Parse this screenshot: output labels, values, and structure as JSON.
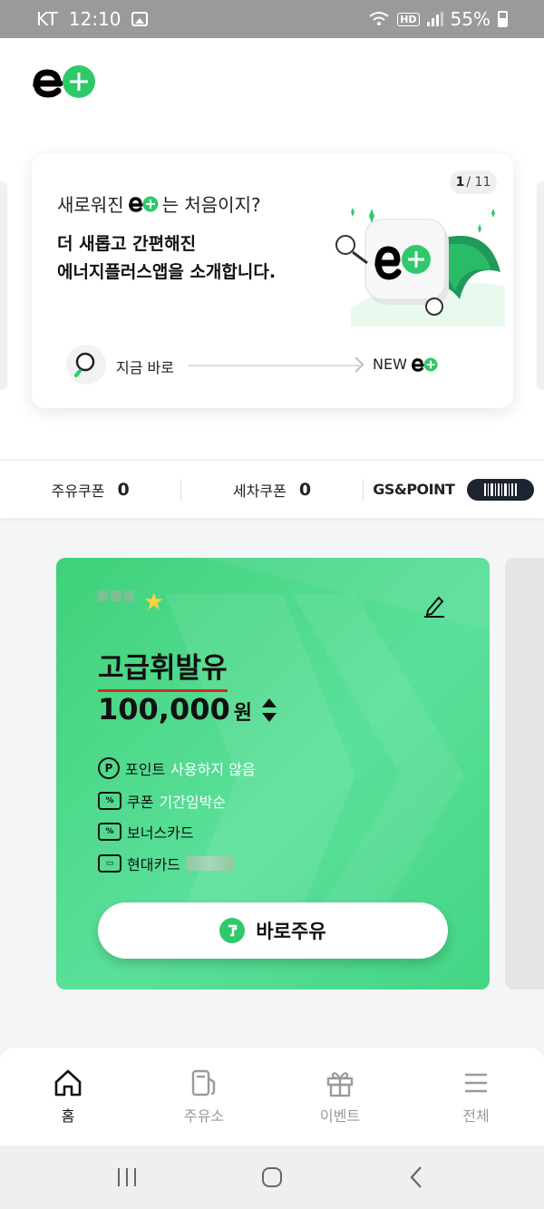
{
  "status_bar": {
    "carrier": "KT",
    "time": "12:10",
    "battery": "55%",
    "network_badge": "HD"
  },
  "banner": {
    "title_before": "새로워진",
    "title_after": "는 처음이지?",
    "subtitle_line1": "더 새롭고 간편해진",
    "subtitle_line2": "에너지플러스앱을 소개합니다.",
    "pager_current": "1",
    "pager_total": "/ 11",
    "now_label": "지금 바로",
    "new_label": "NEW"
  },
  "coupons": {
    "fuel_label": "주유쿠폰",
    "fuel_count": "0",
    "wash_label": "세차쿠폰",
    "wash_count": "0",
    "gs_label": "GS&POINT"
  },
  "fuel_card": {
    "fuel_type": "고급휘발유",
    "amount": "100,000",
    "currency": "원",
    "point_label": "포인트",
    "point_value": "사용하지 않음",
    "coupon_label": "쿠폰",
    "coupon_value": "기간임박순",
    "bonus_card_label": "보너스카드",
    "card_label": "현대카드",
    "action_label": "바로주유"
  },
  "tabs": [
    {
      "label": "홈",
      "icon": "home-icon",
      "active": true
    },
    {
      "label": "주유소",
      "icon": "gas-pump-icon",
      "active": false
    },
    {
      "label": "이벤트",
      "icon": "gift-icon",
      "active": false
    },
    {
      "label": "전체",
      "icon": "menu-icon",
      "active": false
    }
  ],
  "colors": {
    "brand_green": "#2fc96b",
    "card_green": "#4fd98b",
    "underline_red": "#d42a1f",
    "dark_navy": "#1c2331"
  }
}
